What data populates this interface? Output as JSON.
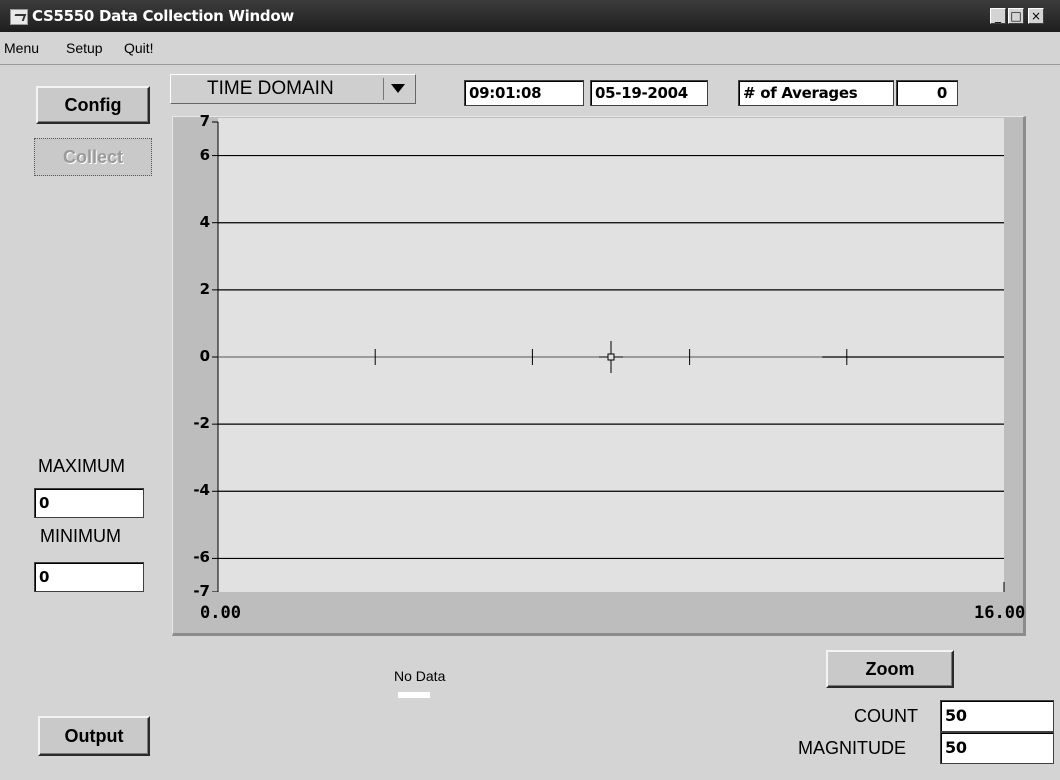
{
  "window": {
    "title": "CS5550 Data Collection Window",
    "controls": [
      "_",
      "□",
      "×"
    ]
  },
  "menu": {
    "items": [
      "Menu",
      "Setup",
      "Quit!"
    ]
  },
  "toolbar": {
    "mode_select": "TIME DOMAIN",
    "time": "09:01:08",
    "date": "05-19-2004",
    "averages_label": "# of Averages",
    "averages_value": "0"
  },
  "buttons": {
    "config": "Config",
    "collect": "Collect",
    "output": "Output",
    "zoom": "Zoom"
  },
  "stats": {
    "maximum_label": "MAXIMUM",
    "maximum_value": "0",
    "minimum_label": "MINIMUM",
    "minimum_value": "0"
  },
  "bottom": {
    "count_label": "COUNT",
    "count_value": "50",
    "magnitude_label": "MAGNITUDE",
    "magnitude_value": "50"
  },
  "chart_data": {
    "type": "line",
    "ytick_labels": [
      "7",
      "6",
      "4",
      "2",
      "0",
      "-2",
      "-4",
      "-6",
      "-7"
    ],
    "yticks": [
      7,
      6,
      4,
      2,
      0,
      -2,
      -4,
      -6,
      -7
    ],
    "xtick_labels": [
      "0.00",
      "16.00"
    ],
    "xlim": [
      0,
      16
    ],
    "ylim": [
      -7,
      7
    ],
    "gridlines_y": [
      6,
      4,
      2,
      -2,
      -4,
      -6
    ],
    "minor_x_marks": [
      3.2,
      6.4,
      9.6,
      12.8
    ],
    "cursor": {
      "x": 8,
      "y": 0
    },
    "series": [
      {
        "values": [
          0,
          0
        ]
      }
    ],
    "legend": "No Data",
    "colors": {
      "plot_bg": "#e1e1e1",
      "grid": "#000000",
      "trace": "#000000"
    }
  }
}
